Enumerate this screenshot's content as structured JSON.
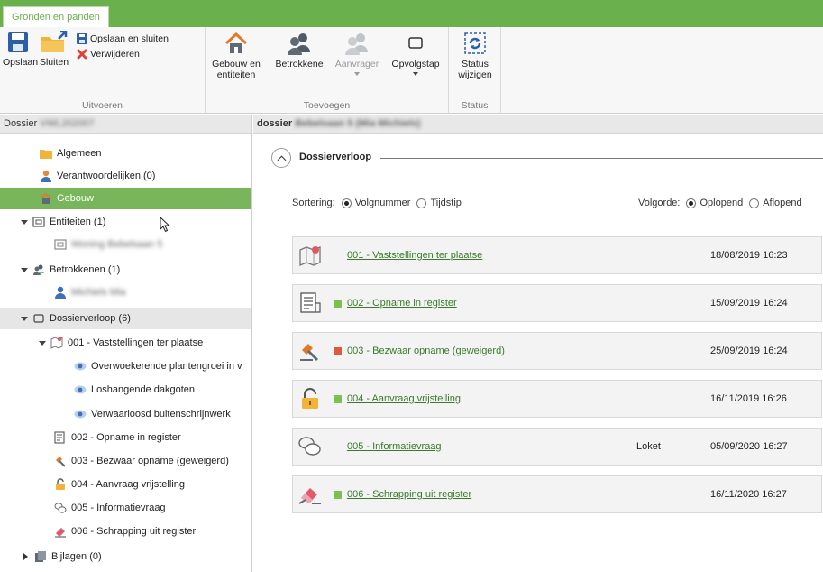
{
  "app": {
    "active_tab": "Gronden en panden"
  },
  "ribbon": {
    "groups": [
      {
        "label": "Uitvoeren"
      },
      {
        "label": "Toevoegen"
      },
      {
        "label": "Status"
      }
    ],
    "opslaan": "Opslaan",
    "sluiten": "Sluiten",
    "opslaan_sluiten": "Opslaan en sluiten",
    "verwijderen": "Verwijderen",
    "gebouw_line1": "Gebouw en",
    "gebouw_line2": "entiteiten",
    "betrokkene": "Betrokkene",
    "aanvrager": "Aanvrager",
    "opvolgstap": "Opvolgstap",
    "status_line1": "Status",
    "status_line2": "wijzigen"
  },
  "left": {
    "header": "Dossier",
    "header_blurred": "VWL202007",
    "items": [
      {
        "label": "Algemeen"
      },
      {
        "label": "Verantwoordelijken (0)"
      },
      {
        "label": "Gebouw"
      },
      {
        "label": "Entiteiten (1)"
      },
      {
        "label": "Woning Bebelsaan 5"
      },
      {
        "label": "Betrokkenen (1)"
      },
      {
        "label": "Michiels Mia"
      },
      {
        "label": "Dossierverloop (6)"
      },
      {
        "label": "001 - Vaststellingen ter plaatse"
      },
      {
        "label": "Overwoekerende plantengroei in v"
      },
      {
        "label": "Loshangende dakgoten"
      },
      {
        "label": "Verwaarloosd buitenschrijnwerk"
      },
      {
        "label": "002 - Opname in register"
      },
      {
        "label": "003 - Bezwaar opname (geweigerd)"
      },
      {
        "label": "004 - Aanvraag vrijstelling"
      },
      {
        "label": "005 - Informatievraag"
      },
      {
        "label": "006 - Schrapping uit register"
      },
      {
        "label": "Bijlagen (0)"
      }
    ]
  },
  "right": {
    "header": "dossier",
    "header_blurred": "Bebelsaan 5 (Mia Michiels)",
    "section_title": "Dossierverloop",
    "sortering_label": "Sortering:",
    "sort_opt1": "Volgnummer",
    "sort_opt2": "Tijdstip",
    "volgorde_label": "Volgorde:",
    "order_opt1": "Oplopend",
    "order_opt2": "Aflopend",
    "steps": [
      {
        "title": "001 - Vaststellingen ter plaatse",
        "extra": "",
        "datetime": "18/08/2019 16:23",
        "icon": "map-icon",
        "status_color": ""
      },
      {
        "title": "002 - Opname in register",
        "extra": "",
        "datetime": "15/09/2019 16:24",
        "icon": "register-icon",
        "status_color": "#7cc04f"
      },
      {
        "title": "003 - Bezwaar opname (geweigerd)",
        "extra": "",
        "datetime": "25/09/2019 16:24",
        "icon": "gavel-icon",
        "status_color": "#e05a3a"
      },
      {
        "title": "004 - Aanvraag vrijstelling",
        "extra": "",
        "datetime": "16/11/2019 16:26",
        "icon": "unlock-icon",
        "status_color": "#7cc04f"
      },
      {
        "title": "005 - Informatievraag",
        "extra": "Loket",
        "datetime": "05/09/2020 16:27",
        "icon": "chat-icon",
        "status_color": ""
      },
      {
        "title": "006 - Schrapping uit register",
        "extra": "",
        "datetime": "16/11/2020 16:27",
        "icon": "eraser-icon",
        "status_color": "#7cc04f"
      }
    ]
  },
  "colors": {
    "accent": "#6ab04c",
    "selected": "#79b65b",
    "link": "#3a7a2a"
  }
}
